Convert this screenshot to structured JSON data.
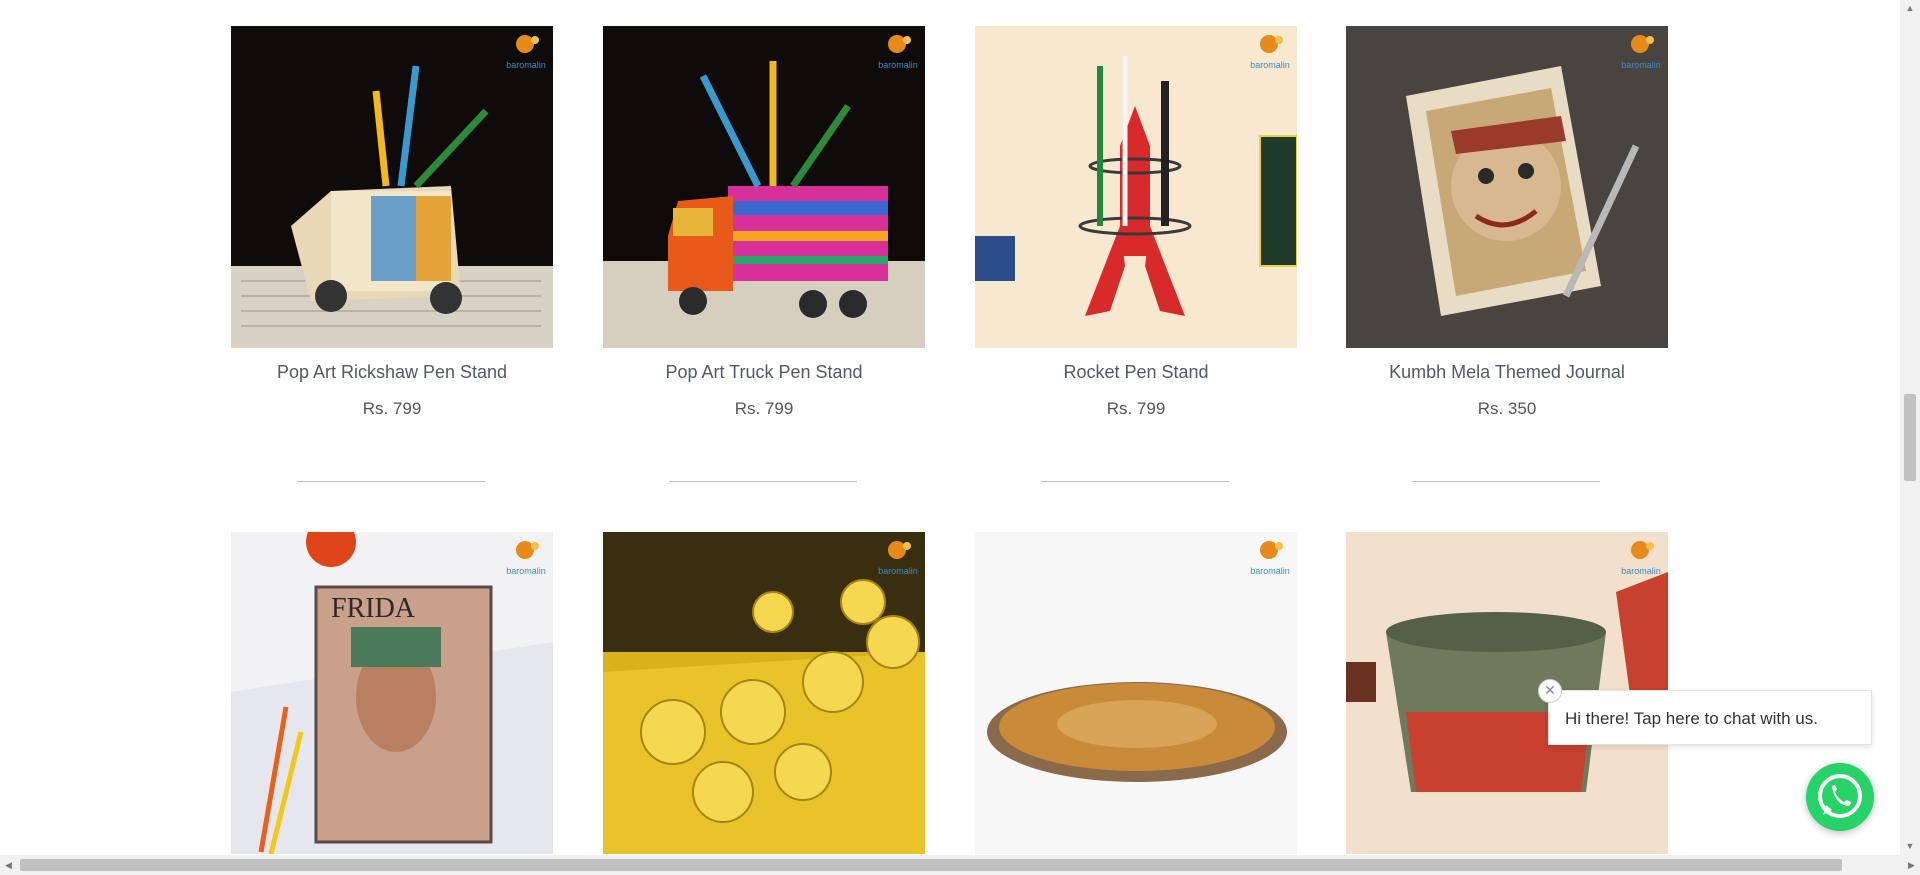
{
  "products": [
    {
      "title": "Pop Art Rickshaw Pen Stand",
      "price": "Rs. 799",
      "image": "rickshaw-pen-stand-photo"
    },
    {
      "title": "Pop Art Truck Pen Stand",
      "price": "Rs. 799",
      "image": "truck-pen-stand-photo"
    },
    {
      "title": "Rocket Pen Stand",
      "price": "Rs. 799",
      "image": "rocket-pen-stand-photo"
    },
    {
      "title": "Kumbh Mela Themed Journal",
      "price": "Rs. 350",
      "image": "kumbh-mela-journal-photo"
    },
    {
      "title": "",
      "price": "",
      "image": "frida-notebook-photo"
    },
    {
      "title": "",
      "price": "",
      "image": "gold-string-lights-photo"
    },
    {
      "title": "",
      "price": "",
      "image": "ceramic-leaf-platter-photo"
    },
    {
      "title": "",
      "price": "",
      "image": "ceramic-bowl-photo"
    }
  ],
  "chat": {
    "message": "Hi there! Tap here to chat with us.",
    "close_icon": "close-icon",
    "button_icon": "whatsapp-icon"
  },
  "colors": {
    "whatsapp_green": "#25d366",
    "title": "#4f5a64"
  }
}
